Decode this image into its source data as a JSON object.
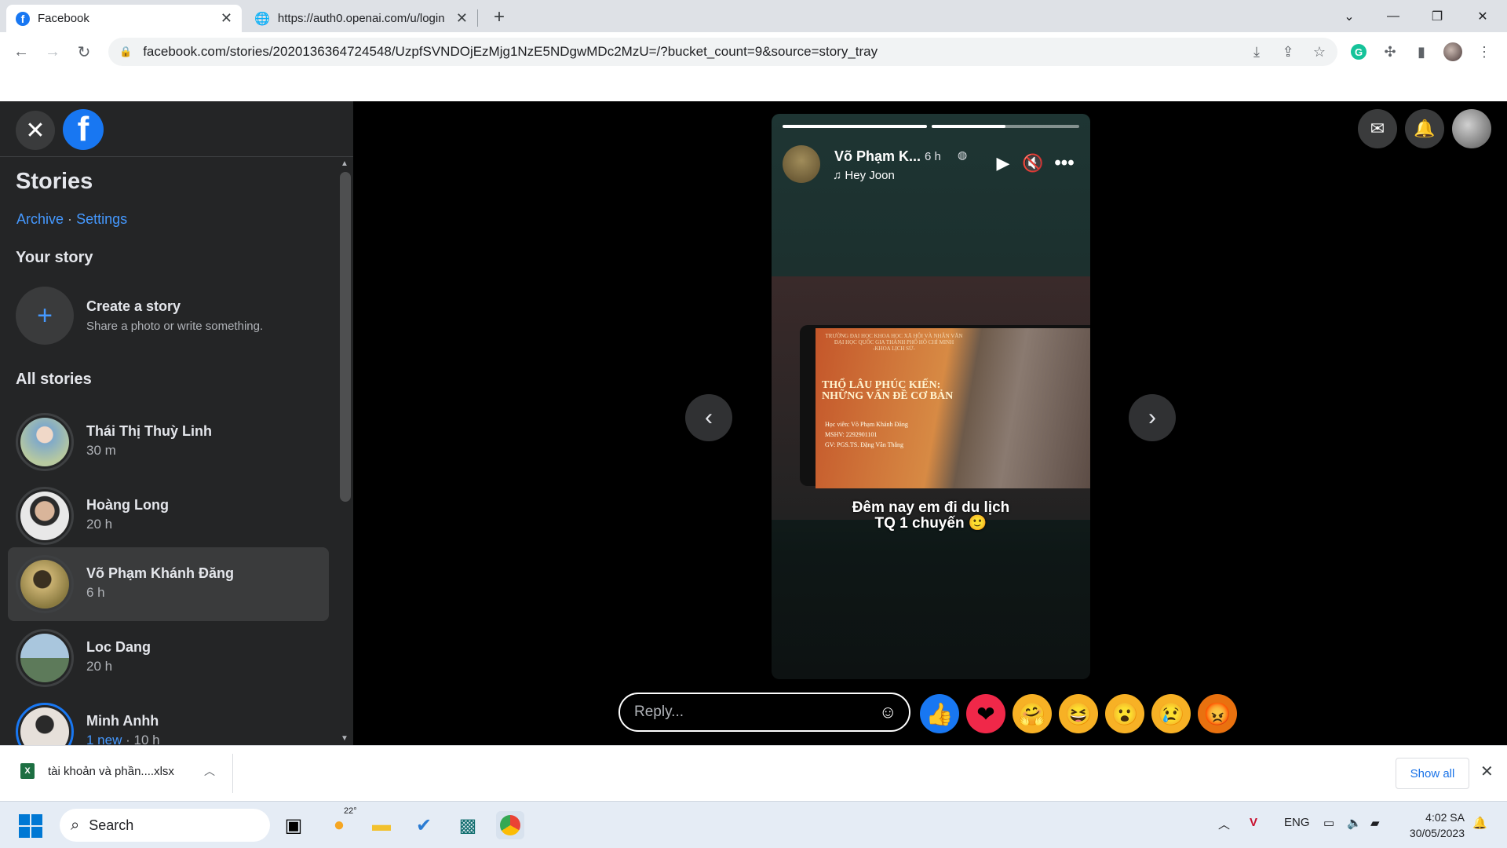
{
  "browser": {
    "tabs": [
      {
        "title": "Facebook",
        "icon": "facebook-icon",
        "active": true
      },
      {
        "title": "https://auth0.openai.com/u/login",
        "icon": "globe-icon",
        "active": false
      }
    ],
    "url": "facebook.com/stories/2020136364724548/UzpfSVNDOjEzMjg1NzE5NDgwMDc2MzU=/?bucket_count=9&source=story_tray"
  },
  "sidebar": {
    "title": "Stories",
    "archive_label": "Archive",
    "separator": "·",
    "settings_label": "Settings",
    "your_story_heading": "Your story",
    "create_title": "Create a story",
    "create_subtitle": "Share a photo or write something.",
    "all_stories_heading": "All stories",
    "stories": [
      {
        "name": "Thái Thị Thuỳ Linh",
        "time": "30 m",
        "avatar_color": "#7fa9c9"
      },
      {
        "name": "Hoàng Long",
        "time": "20 h",
        "avatar_color": "#c9b29a"
      },
      {
        "name": "Võ Phạm Khánh Đăng",
        "time": "6 h",
        "avatar_color": "#b8a15c",
        "active": true
      },
      {
        "name": "Loc Dang",
        "time": "20 h",
        "avatar_color": "#8fb0c7"
      },
      {
        "name": "Minh Anhh",
        "new_label": "1 new",
        "time": "· 10 h",
        "avatar_color": "#d8d0c8"
      }
    ]
  },
  "story": {
    "author": "Võ Phạm K...",
    "time": "6 h",
    "music": "Hey Joon",
    "slide_header": "TRƯỜNG ĐẠI HỌC KHOA HỌC XÃ HỘI VÀ NHÂN VĂN\nĐẠI HỌC QUỐC GIA THÀNH PHỐ HỒ CHÍ MINH\n-KHOA LỊCH SỬ-",
    "slide_title_1": "THỔ LÂU PHÚC KIẾN:",
    "slide_title_2": "NHỮNG VẤN ĐỀ CƠ BẢN",
    "slide_meta_1": "Học viên: Võ Phạm Khánh Đăng",
    "slide_meta_2": "MSHV: 2292901101",
    "slide_meta_3": "GV: PGS.TS. Đặng Văn Thắng",
    "caption_1": "Đêm nay em đi du lịch",
    "caption_2": "TQ 1 chuyến 🙂",
    "progress": [
      1.0,
      0.5
    ]
  },
  "reply": {
    "placeholder": "Reply..."
  },
  "reactions": [
    {
      "name": "like",
      "glyph": "👍",
      "bg": "#1877f2"
    },
    {
      "name": "love",
      "glyph": "❤",
      "bg": "#f02849"
    },
    {
      "name": "care",
      "glyph": "🤗",
      "bg": "#f7b125"
    },
    {
      "name": "haha",
      "glyph": "😆",
      "bg": "#f7b125"
    },
    {
      "name": "wow",
      "glyph": "😮",
      "bg": "#f7b125"
    },
    {
      "name": "sad",
      "glyph": "😢",
      "bg": "#f7b125"
    },
    {
      "name": "angry",
      "glyph": "😡",
      "bg": "#e9710f"
    }
  ],
  "download": {
    "filename": "tài khoản và phần....xlsx",
    "show_all": "Show all"
  },
  "taskbar": {
    "search": "Search",
    "weather": "22°",
    "lang": "ENG",
    "time": "4:02 SA",
    "date": "30/05/2023"
  }
}
